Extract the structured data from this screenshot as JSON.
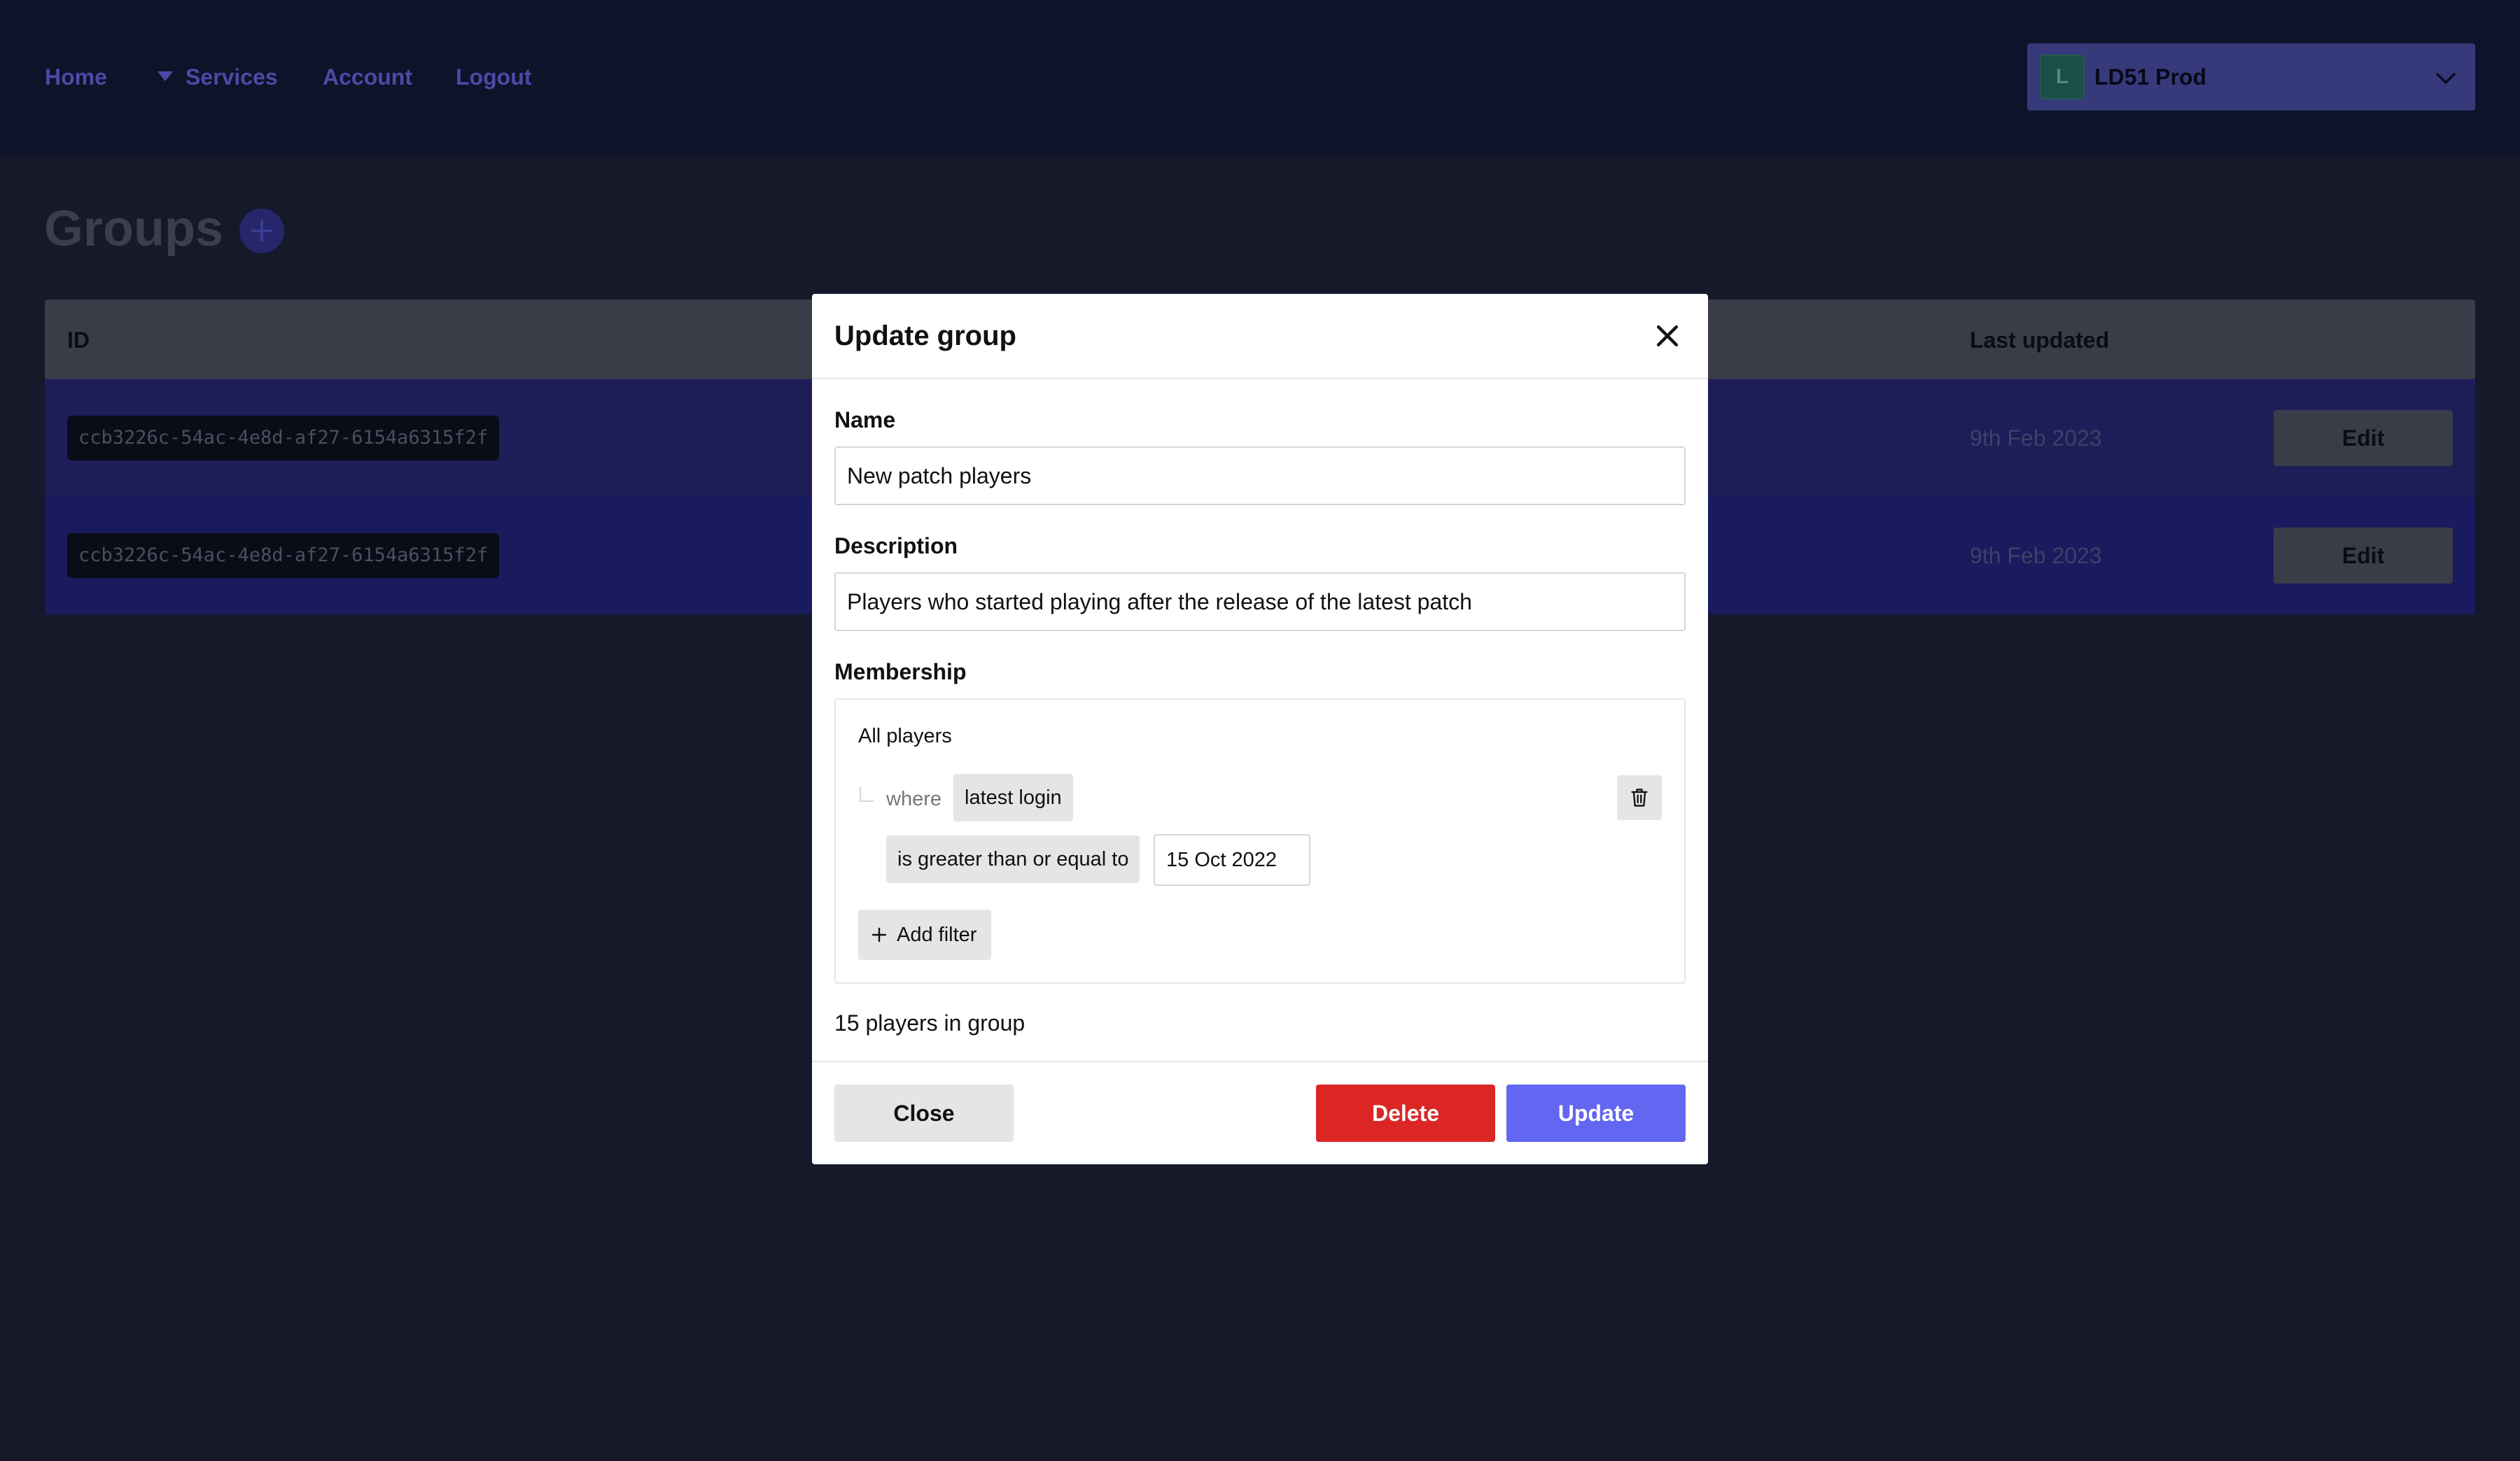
{
  "nav": {
    "links": [
      "Home",
      "Services",
      "Account",
      "Logout"
    ],
    "environment": {
      "avatar_letter": "L",
      "name": "LD51 Prod"
    }
  },
  "page": {
    "title": "Groups"
  },
  "table": {
    "headers": {
      "id": "ID",
      "last_updated": "Last updated"
    },
    "rows": [
      {
        "id": "ccb3226c-54ac-4e8d-af27-6154a6315f2f",
        "last_updated": "9th Feb 2023",
        "action": "Edit"
      },
      {
        "id": "ccb3226c-54ac-4e8d-af27-6154a6315f2f",
        "last_updated": "9th Feb 2023",
        "action": "Edit"
      }
    ]
  },
  "modal": {
    "title": "Update group",
    "name_label": "Name",
    "name_value": "New patch players",
    "description_label": "Description",
    "description_value": "Players who started playing after the release of the latest patch",
    "membership_label": "Membership",
    "membership": {
      "scope": "All players",
      "where": "where",
      "property": "latest login",
      "operator": "is greater than or equal to",
      "value": "15 Oct 2022",
      "add_filter": "Add filter"
    },
    "players_count": "15 players in group",
    "buttons": {
      "close": "Close",
      "delete": "Delete",
      "update": "Update"
    }
  },
  "colors": {
    "accent": "#6366f1",
    "danger": "#dc2626"
  },
  "icons": [
    "chevron-down-icon",
    "plus-icon",
    "close-icon",
    "trash-icon",
    "caret-down-icon"
  ]
}
